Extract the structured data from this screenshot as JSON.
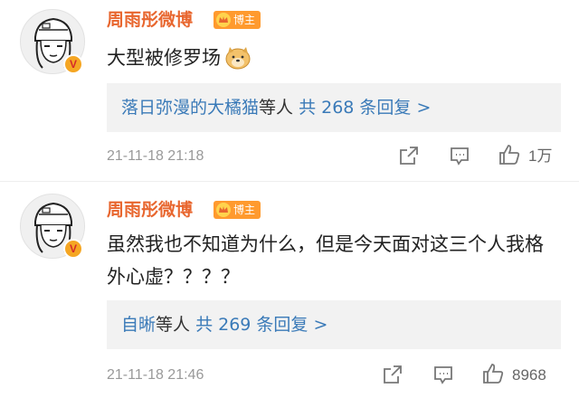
{
  "colors": {
    "author": "#e8662e",
    "link": "#3a7ab8",
    "badge": "#ff9a2e",
    "reply_bg": "#f2f2f2"
  },
  "comments": [
    {
      "author": "周雨彤微博",
      "role_badge": "博主",
      "verified_mark": "V",
      "content": "大型被修罗场",
      "emoji": "doge-emoji",
      "replies": {
        "users": "落日弥漫的大橘猫",
        "suffix": "等人",
        "count_text": "共 268 条回复 >"
      },
      "time": "21-11-18 21:18",
      "likes": "1万"
    },
    {
      "author": "周雨彤微博",
      "role_badge": "博主",
      "verified_mark": "V",
      "content": "虽然我也不知道为什么，但是今天面对这三个人我格外心虚？？？？",
      "replies": {
        "users": "自晰",
        "suffix": "等人",
        "count_text": "共 269 条回复 >"
      },
      "time": "21-11-18 21:46",
      "likes": "8968"
    }
  ],
  "icons": {
    "share": "share-icon",
    "comment": "comment-icon",
    "like": "thumbs-up-icon"
  }
}
